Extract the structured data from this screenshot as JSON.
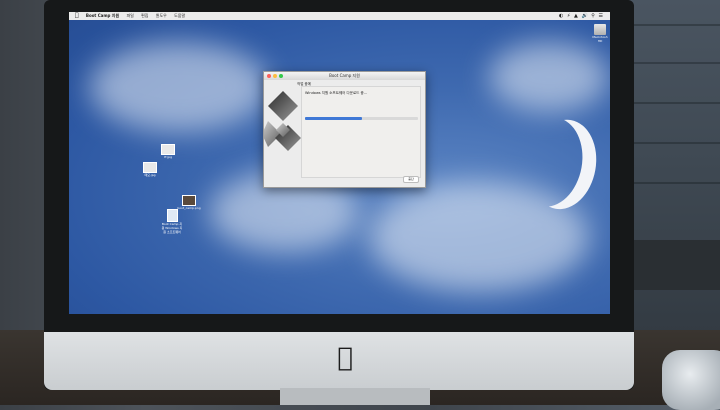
{
  "menubar": {
    "apple_icon": "apple-icon",
    "app_name": "Boot Camp 지원",
    "items": [
      "파일",
      "편집",
      "윈도우",
      "도움말"
    ],
    "status_glyphs": "◐ ⚡ ▲ 🔊 ⚲ ☰"
  },
  "desktop": {
    "hdd_label": "Macintosh HD",
    "icons": [
      {
        "label": "IT.jpg"
      },
      {
        "label": "메모.jpg"
      },
      {
        "label": "boot_camp.png"
      },
      {
        "label": "Boot Camp 지원 Windows 지원 소프트웨어"
      }
    ]
  },
  "window": {
    "title": "Boot Camp 지원",
    "section_title": "작업 중에",
    "status_text": "Windows 지원 소프트웨어 다운로드 중...",
    "progress_fraction": 0.5,
    "stop_button_label": "중단"
  },
  "colors": {
    "wallpaper_sky": "#2d58a3",
    "progress_blue": "#3f78d6",
    "close_red": "#fc605c",
    "minimize_yellow": "#fdbc40",
    "zoom_green": "#34c84a"
  },
  "hardware": {
    "logo_icon": "apple-logo-icon"
  }
}
